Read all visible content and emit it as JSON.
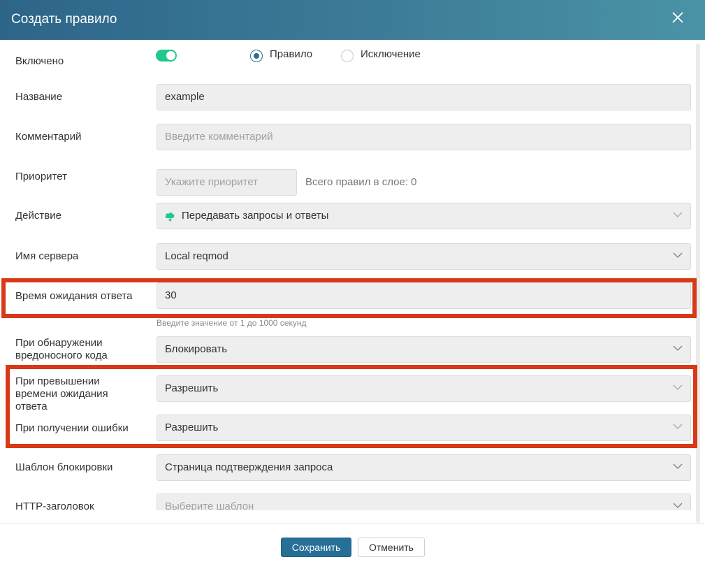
{
  "dialog": {
    "title": "Создать правило"
  },
  "form": {
    "enabled": {
      "label": "Включено",
      "value": true
    },
    "type": {
      "options": [
        {
          "label": "Правило",
          "selected": true
        },
        {
          "label": "Исключение",
          "selected": false
        }
      ]
    },
    "name": {
      "label": "Название",
      "value": "example"
    },
    "comment": {
      "label": "Комментарий",
      "placeholder": "Введите комментарий"
    },
    "priority": {
      "label": "Приоритет",
      "placeholder": "Укажите приоритет",
      "info": "Всего правил в слое: 0"
    },
    "action": {
      "label": "Действие",
      "value": "Передавать запросы и ответы",
      "icon": "cloud-icon"
    },
    "server": {
      "label": "Имя сервера",
      "value": "Local reqmod"
    },
    "timeout": {
      "label": "Время ожидания ответа",
      "value": "30",
      "hint": "Введите значение от 1 до 1000 секунд"
    },
    "on_malware": {
      "label_line1": "При обнаружении",
      "label_line2": "вредоносного кода",
      "value": "Блокировать"
    },
    "on_timeout": {
      "label_line1": "При превышении",
      "label_line2": "времени ожидания",
      "label_line3": "ответа",
      "value": "Разрешить"
    },
    "on_error": {
      "label": "При получении ошибки",
      "value": "Разрешить"
    },
    "block_template": {
      "label": "Шаблон блокировки",
      "value": "Страница подтверждения запроса"
    },
    "http_header": {
      "label": "HTTP-заголовок",
      "placeholder": "Выберите шаблон"
    }
  },
  "footer": {
    "save_label": "Сохранить",
    "cancel_label": "Отменить"
  },
  "colors": {
    "header_start": "#2d6589",
    "header_end": "#4a93a6",
    "toggle_on": "#1ec98a",
    "primary_button": "#266f97",
    "highlight": "#d83a17"
  }
}
